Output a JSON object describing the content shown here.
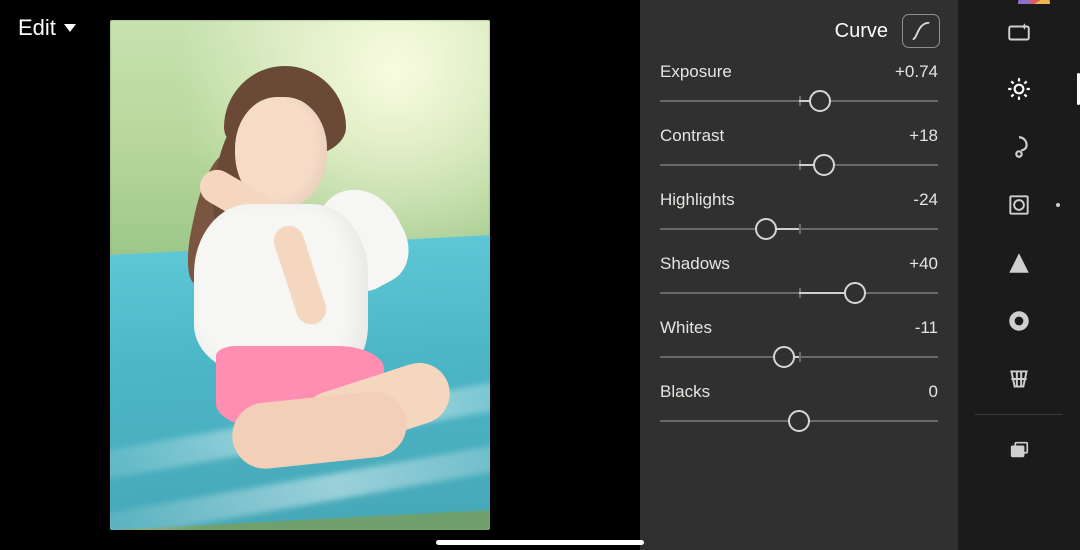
{
  "topbar": {
    "mode_label": "Edit",
    "icons": {
      "undo": "undo-icon",
      "help": "help-icon",
      "share": "share-icon",
      "cloud": "cloud-icon",
      "cloud_alert": "!",
      "more": "more-icon"
    }
  },
  "panel": {
    "curve_label": "Curve",
    "sliders": [
      {
        "label": "Exposure",
        "value_text": "+0.74",
        "min": -5,
        "max": 5,
        "value": 0.74
      },
      {
        "label": "Contrast",
        "value_text": "+18",
        "min": -100,
        "max": 100,
        "value": 18
      },
      {
        "label": "Highlights",
        "value_text": "-24",
        "min": -100,
        "max": 100,
        "value": -24
      },
      {
        "label": "Shadows",
        "value_text": "+40",
        "min": -100,
        "max": 100,
        "value": 40
      },
      {
        "label": "Whites",
        "value_text": "-11",
        "min": -100,
        "max": 100,
        "value": -11
      },
      {
        "label": "Blacks",
        "value_text": "0",
        "min": -100,
        "max": 100,
        "value": 0
      }
    ]
  },
  "toolstrip": {
    "tools": [
      {
        "name": "presets-icon",
        "active": false,
        "dot": false
      },
      {
        "name": "auto-icon",
        "active": false,
        "dot": false
      },
      {
        "name": "light-icon",
        "active": true,
        "dot": false
      },
      {
        "name": "color-icon",
        "active": false,
        "dot": false
      },
      {
        "name": "effects-icon",
        "active": false,
        "dot": true
      },
      {
        "name": "detail-icon",
        "active": false,
        "dot": false
      },
      {
        "name": "optics-icon",
        "active": false,
        "dot": false
      },
      {
        "name": "geometry-icon",
        "active": false,
        "dot": false
      },
      {
        "name": "versions-icon",
        "active": false,
        "dot": false
      }
    ]
  }
}
